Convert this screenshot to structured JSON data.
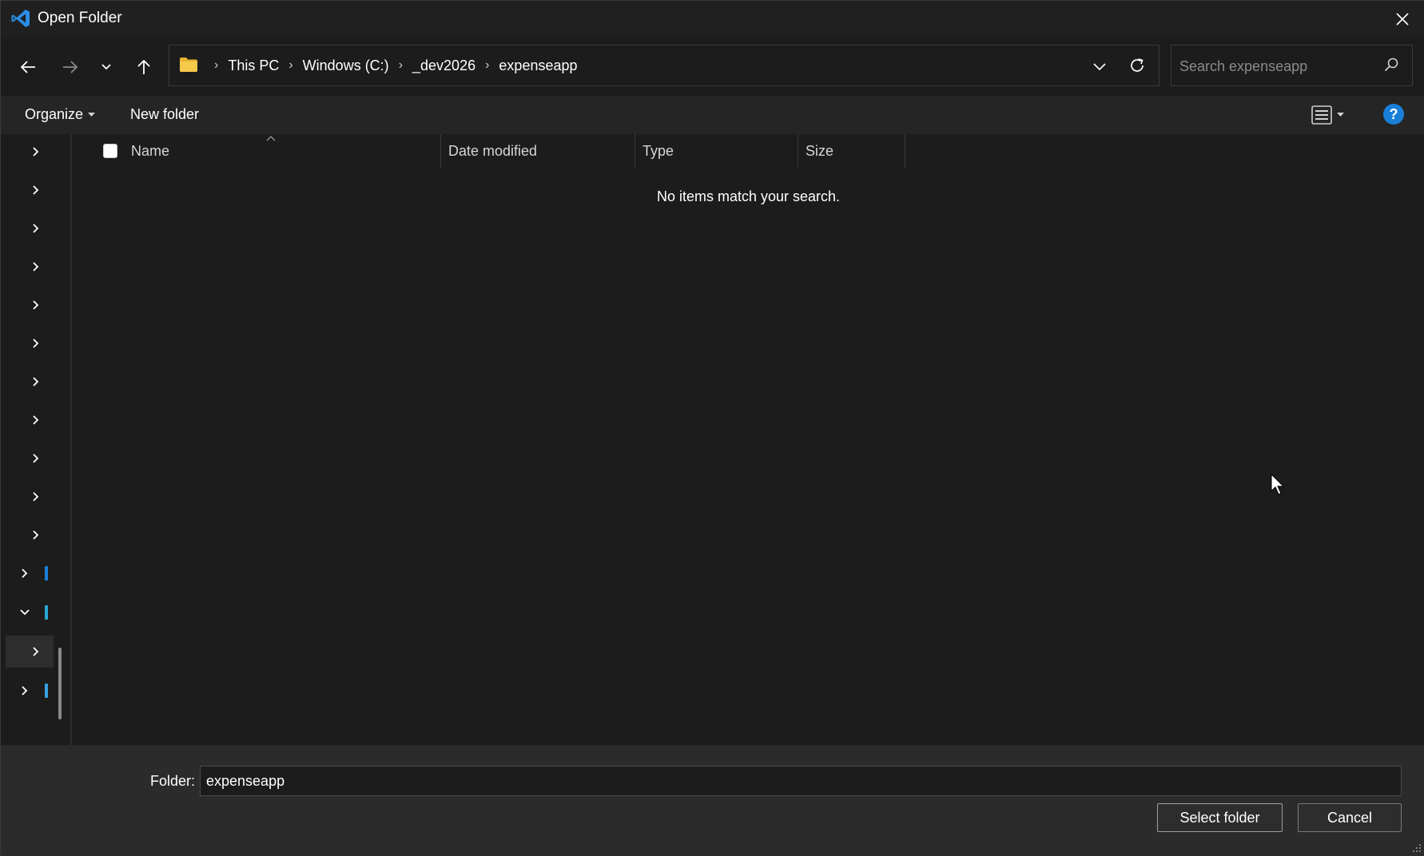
{
  "window": {
    "title": "Open Folder",
    "accent": "#1a7fd9"
  },
  "nav": {
    "back_icon": "arrow-left-icon",
    "forward_icon": "arrow-right-icon",
    "recent_icon": "chevron-down-icon",
    "up_icon": "arrow-up-icon"
  },
  "address": {
    "crumbs": [
      "This PC",
      "Windows (C:)",
      "_dev2026",
      "expenseapp"
    ]
  },
  "search": {
    "placeholder": "Search expenseapp"
  },
  "commands": {
    "organize": "Organize",
    "new_folder": "New folder",
    "help": "?"
  },
  "columns": {
    "name": "Name",
    "date_modified": "Date modified",
    "type": "Type",
    "size": "Size"
  },
  "list": {
    "empty_message": "No items match your search."
  },
  "tree": {
    "items": [
      {
        "state": "collapsed"
      },
      {
        "state": "collapsed"
      },
      {
        "state": "collapsed"
      },
      {
        "state": "collapsed"
      },
      {
        "state": "collapsed"
      },
      {
        "state": "collapsed"
      },
      {
        "state": "collapsed"
      },
      {
        "state": "collapsed"
      },
      {
        "state": "collapsed"
      },
      {
        "state": "collapsed"
      },
      {
        "state": "collapsed"
      },
      {
        "state": "collapsed",
        "color": "#1a7fd9"
      },
      {
        "state": "expanded",
        "color": "#2aa7d6"
      },
      {
        "state": "collapsed",
        "selected": true
      },
      {
        "state": "collapsed",
        "color": "#3aa0e0"
      }
    ]
  },
  "footer": {
    "folder_label": "Folder:",
    "folder_value": "expenseapp",
    "select_label": "Select folder",
    "cancel_label": "Cancel"
  }
}
